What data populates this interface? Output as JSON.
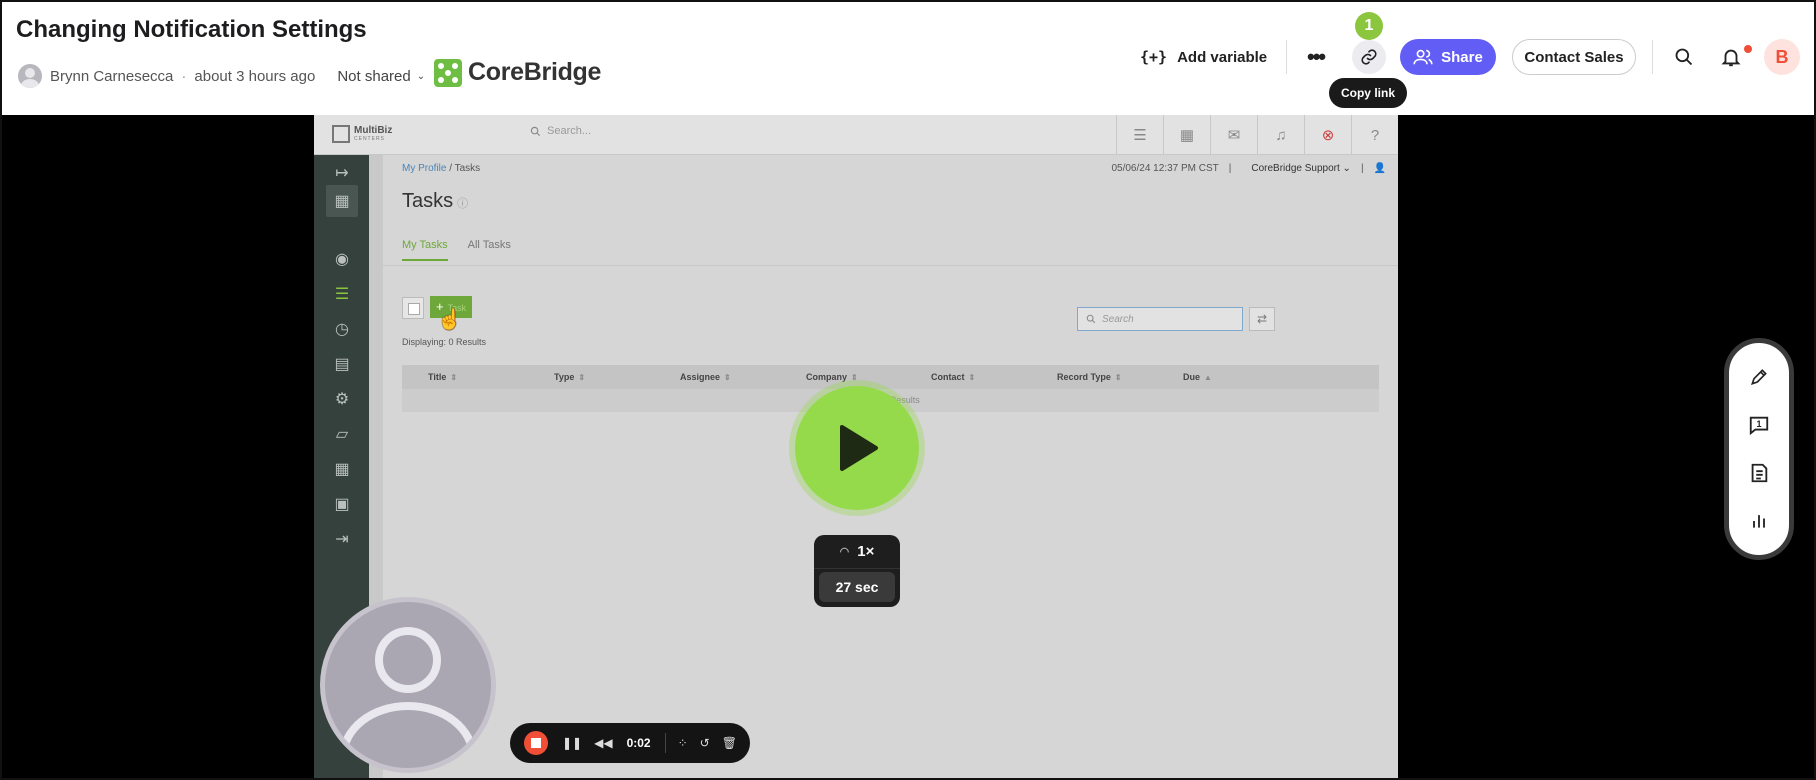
{
  "header": {
    "title": "Changing Notification Settings",
    "author": "Brynn Carnesecca",
    "time_ago": "about 3 hours ago",
    "share_status": "Not shared",
    "brand": "CoreBridge",
    "add_variable": "Add variable",
    "add_variable_icon": "{+}",
    "copy_link_badge": "1",
    "copy_link_tooltip": "Copy link",
    "share_label": "Share",
    "contact_sales_label": "Contact Sales",
    "user_initial": "B",
    "accent": "#625df5",
    "notification_dot_color": "#f04e37"
  },
  "app": {
    "logo_name": "MultiBiz",
    "logo_sub": "CENTERS",
    "search_placeholder": "Search...",
    "breadcrumb_link": "My Profile",
    "breadcrumb_sep": " / ",
    "breadcrumb_current": "Tasks",
    "datetime": "05/06/24 12:37 PM CST",
    "support_label": "CoreBridge Support",
    "page_title": "Tasks",
    "tabs": [
      {
        "label": "My Tasks",
        "active": true
      },
      {
        "label": "All Tasks",
        "active": false
      }
    ],
    "add_button_plus": "+",
    "add_button_label": "Task",
    "displaying_text": "Displaying: 0 Results",
    "table_search_placeholder": "Search",
    "columns": [
      "Title",
      "Type",
      "Assignee",
      "Company",
      "Contact",
      "Record Type",
      "Due"
    ],
    "end_of_results": "End of Results",
    "sidebar_icons": [
      "expand-icon",
      "apps-grid-icon",
      "profile-icon",
      "tasks-icon",
      "timer-icon",
      "inbox-icon",
      "settings-icon",
      "folder-icon",
      "calendar-icon",
      "clipboard-icon",
      "logout-icon"
    ],
    "top_icons": [
      "tasks-icon",
      "calendar-icon",
      "chat-icon",
      "bell-icon",
      "stopwatch-icon",
      "help-icon"
    ],
    "brand_green": "#6fa83a"
  },
  "player": {
    "speed": "1×",
    "duration": "27 sec",
    "elapsed": "0:02",
    "play_color": "#95da4a"
  },
  "right_tools": {
    "comment_count": "1",
    "icons": [
      "pencil-icon",
      "comment-icon",
      "transcript-icon",
      "analytics-icon"
    ]
  }
}
